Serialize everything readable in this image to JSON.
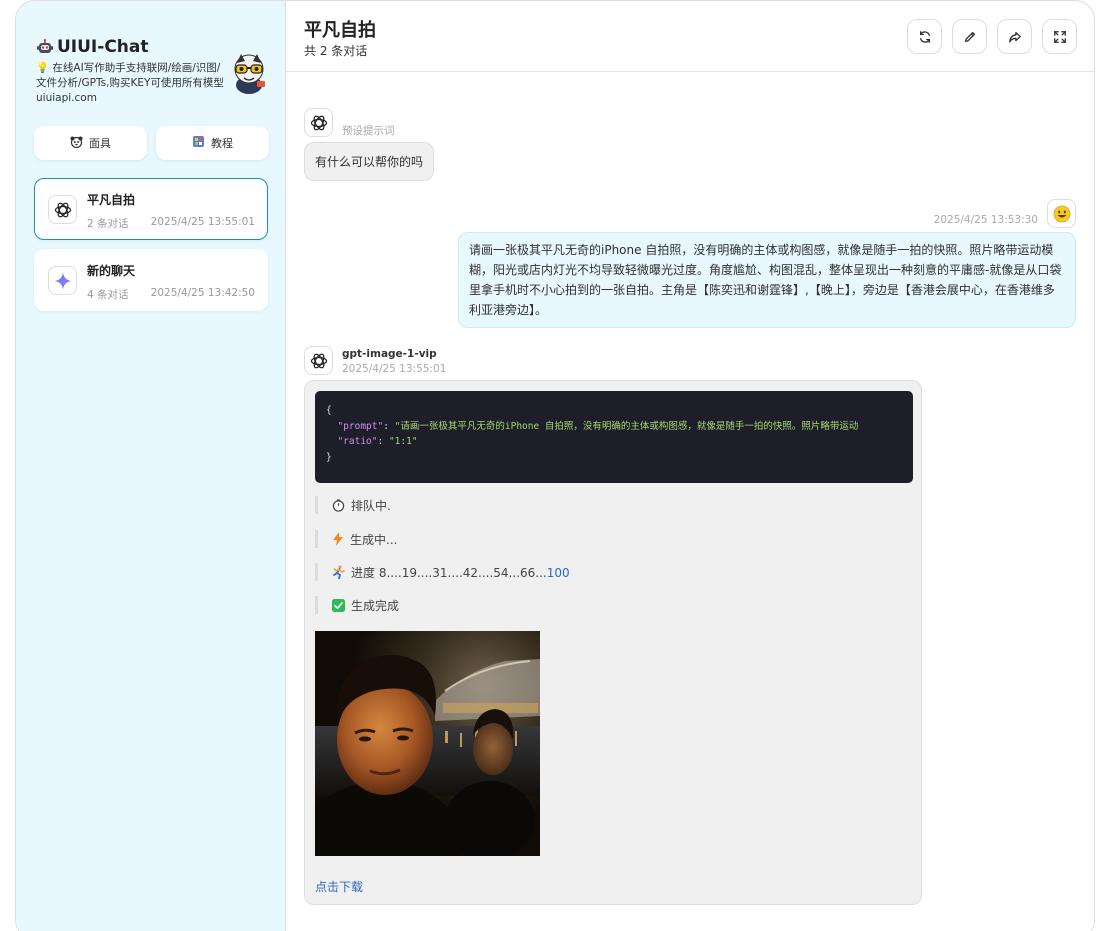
{
  "sidebar": {
    "brand_title": "UIUI-Chat",
    "brand_line1": "在线AI写作助手支持联网/绘画/识图/",
    "brand_line2": "文件分析/GPTs,购买KEY可使用所有模型",
    "brand_line3": "uiuiapi.com",
    "buttons": [
      {
        "label": "面具",
        "icon": "mask-icon"
      },
      {
        "label": "教程",
        "icon": "tutorial-icon"
      }
    ],
    "chats": [
      {
        "title": "平凡自拍",
        "count": "2 条对话",
        "time": "2025/4/25 13:55:01",
        "icon": "openai-icon"
      },
      {
        "title": "新的聊天",
        "count": "4 条对话",
        "time": "2025/4/25 13:42:50",
        "icon": "sparkle-icon"
      }
    ]
  },
  "header": {
    "title": "平凡自拍",
    "subtitle": "共 2 条对话",
    "actions": [
      "refresh-icon",
      "edit-icon",
      "share-icon",
      "fullscreen-icon"
    ]
  },
  "messages": {
    "system_hint": "预设提示词",
    "system_text": "有什么可以帮你的吗",
    "user_time": "2025/4/25 13:53:30",
    "user_text": "请画一张极其平凡无奇的iPhone 自拍照，没有明确的主体或构图感，就像是随手一拍的快照。照片略带运动模糊，阳光或店内灯光不均导致轻微曝光过度。角度尴尬、构图混乱，整体呈现出一种刻意的平庸感-就像是从口袋里拿手机时不小心拍到的一张自拍。主角是【陈奕迅和谢霆锋】,【晚上】，旁边是【香港会展中心，在香港维多利亚港旁边】。",
    "bot_model": "gpt-image-1-vip",
    "bot_time": "2025/4/25 13:55:01",
    "code": {
      "open": "{",
      "prompt_key": "\"prompt\"",
      "prompt_value": "\"请画一张极其平凡无奇的iPhone 自拍照，没有明确的主体或构图感，就像是随手一拍的快照。照片略带运动",
      "ratio_key": "\"ratio\"",
      "ratio_value": "\"1:1\"",
      "close": "}"
    },
    "status": {
      "queue": "排队中.",
      "generating": "生成中...",
      "progress_prefix": "进度 8....19....31....42....54...66...",
      "progress_final": "100",
      "done": "生成完成"
    },
    "download": "点击下载"
  },
  "colors": {
    "sidebar_bg": "#e7f8ff",
    "accent": "#1d93ab",
    "link": "#2a6bbd",
    "code_bg": "#1e1e2a"
  }
}
